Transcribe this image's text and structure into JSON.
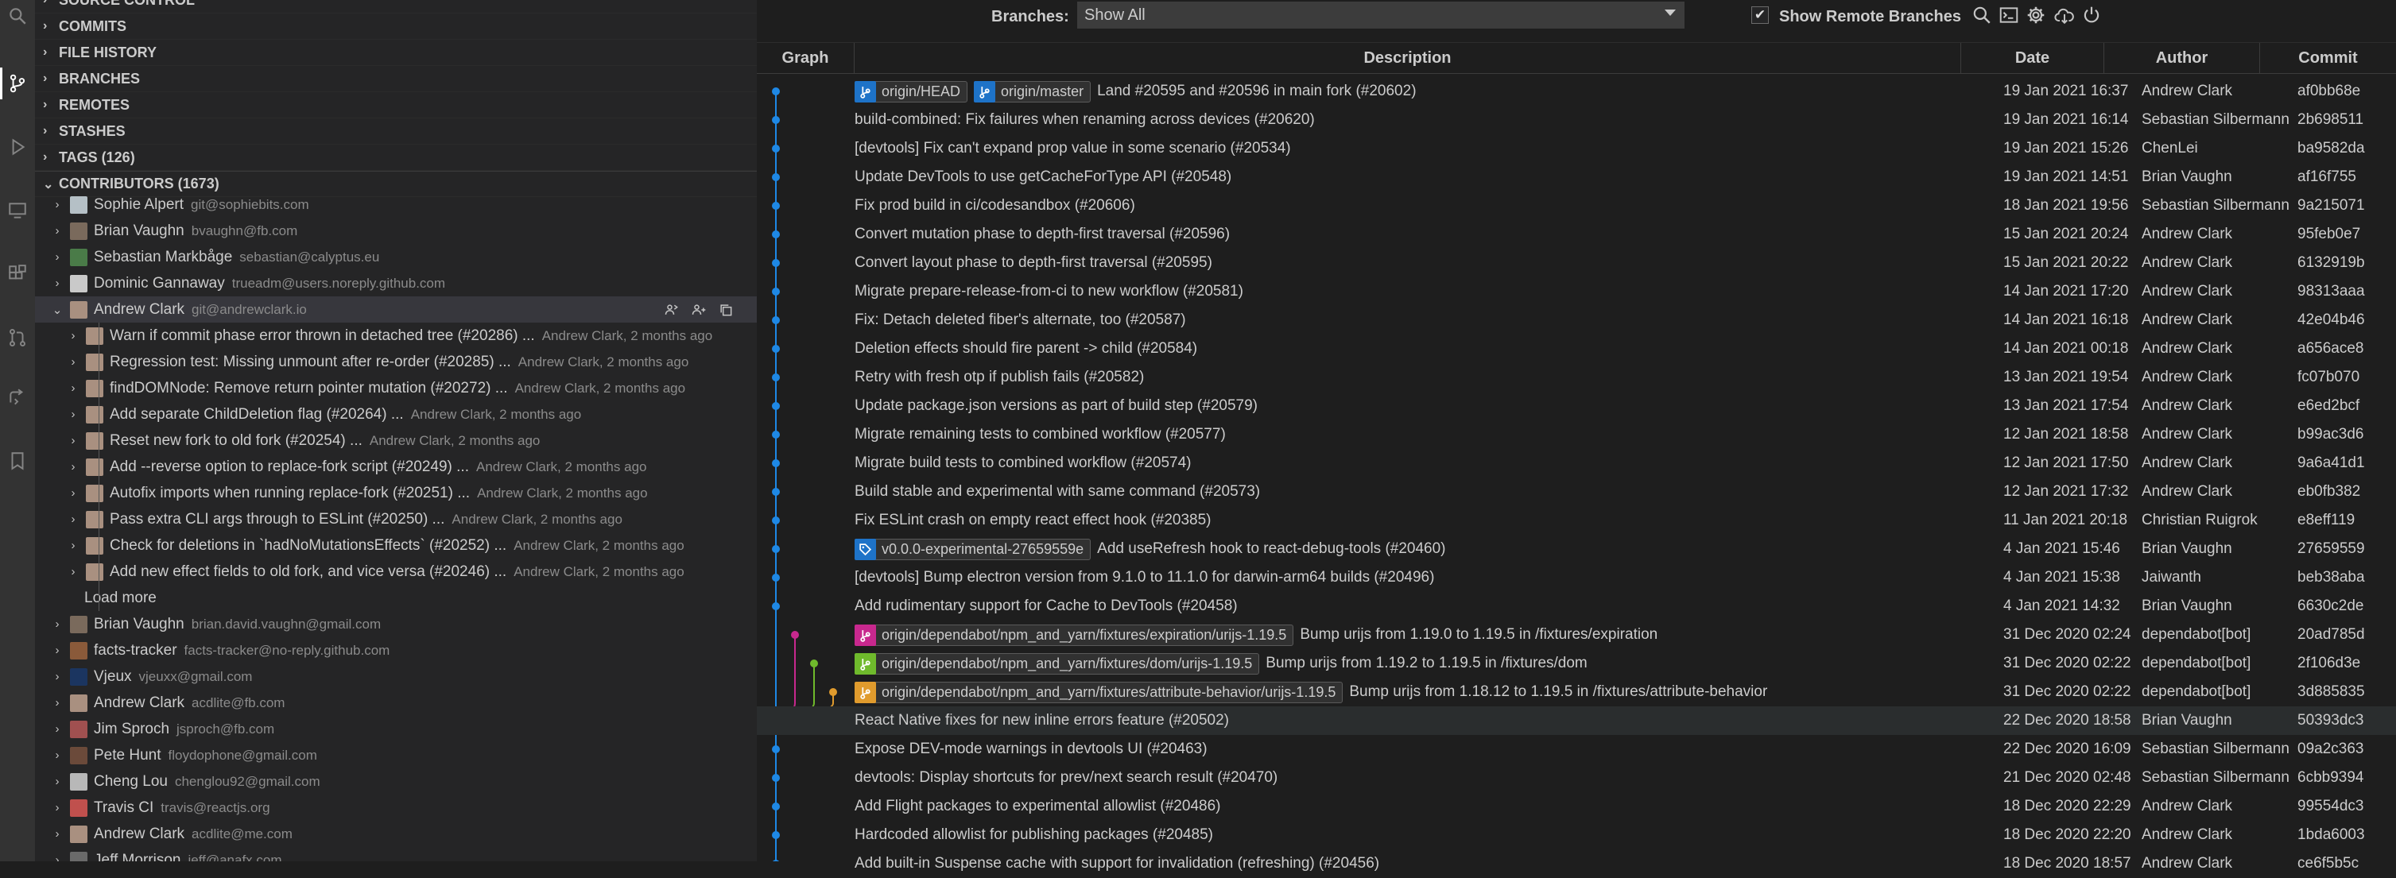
{
  "sidebar": {
    "sections": [
      {
        "label": "SOURCE CONTROL"
      },
      {
        "label": "COMMITS"
      },
      {
        "label": "FILE HISTORY"
      },
      {
        "label": "BRANCHES"
      },
      {
        "label": "REMOTES"
      },
      {
        "label": "STASHES"
      },
      {
        "label": "TAGS (126)"
      }
    ],
    "contributors_header": "CONTRIBUTORS (1673)",
    "contributors": [
      {
        "name": "Sophie Alpert",
        "email": "git@sophiebits.com",
        "color": "#b5c0c6"
      },
      {
        "name": "Brian Vaughn",
        "email": "bvaughn@fb.com",
        "color": "#7a6a5c"
      },
      {
        "name": "Sebastian Markbåge",
        "email": "sebastian@calyptus.eu",
        "color": "#4a7b48"
      },
      {
        "name": "Dominic Gannaway",
        "email": "trueadm@users.noreply.github.com",
        "color": "#c9c9c9"
      },
      {
        "name": "Andrew Clark",
        "email": "git@andrewclark.io",
        "color": "#a99080",
        "selected": true,
        "commits": [
          {
            "message": "Warn if commit phase error thrown in detached tree (#20286) ...",
            "desc": "Andrew Clark, 2 months ago"
          },
          {
            "message": "Regression test: Missing unmount after re-order (#20285) ...",
            "desc": "Andrew Clark, 2 months ago"
          },
          {
            "message": "findDOMNode: Remove return pointer mutation (#20272) ...",
            "desc": "Andrew Clark, 2 months ago"
          },
          {
            "message": "Add separate ChildDeletion flag (#20264) ...",
            "desc": "Andrew Clark, 2 months ago"
          },
          {
            "message": "Reset new fork to old fork  (#20254) ...",
            "desc": "Andrew Clark, 2 months ago"
          },
          {
            "message": "Add --reverse option to replace-fork script (#20249) ...",
            "desc": "Andrew Clark, 2 months ago"
          },
          {
            "message": "Autofix imports when running replace-fork (#20251) ...",
            "desc": "Andrew Clark, 2 months ago"
          },
          {
            "message": "Pass extra CLI args through to ESLint (#20250) ...",
            "desc": "Andrew Clark, 2 months ago"
          },
          {
            "message": "Check for deletions in `hadNoMutationsEffects` (#20252) ...",
            "desc": "Andrew Clark, 2 months ago"
          },
          {
            "message": "Add new effect fields to old fork, and vice versa (#20246) ...",
            "desc": "Andrew Clark, 2 months ago"
          }
        ],
        "load_more": "Load more"
      },
      {
        "name": "Brian Vaughn",
        "email": "brian.david.vaughn@gmail.com",
        "color": "#7a6a5c"
      },
      {
        "name": "facts-tracker",
        "email": "facts-tracker@no-reply.github.com",
        "color": "#8a5a3a"
      },
      {
        "name": "Vjeux",
        "email": "vjeuxx@gmail.com",
        "color": "#1b3560"
      },
      {
        "name": "Andrew Clark",
        "email": "acdlite@fb.com",
        "color": "#a99080"
      },
      {
        "name": "Jim Sproch",
        "email": "jsproch@fb.com",
        "color": "#a05050"
      },
      {
        "name": "Pete Hunt",
        "email": "floydophone@gmail.com",
        "color": "#6b4a3a"
      },
      {
        "name": "Cheng Lou",
        "email": "chenglou92@gmail.com",
        "color": "#b8b8b8"
      },
      {
        "name": "Travis CI",
        "email": "travis@reactjs.org",
        "color": "#c0504d"
      },
      {
        "name": "Andrew Clark",
        "email": "acdlite@me.com",
        "color": "#a99080"
      },
      {
        "name": "Jeff Morrison",
        "email": "jeff@anafx.com",
        "color": "#6a6a6a"
      }
    ]
  },
  "activity_icons": [
    "search-icon",
    "source-control-icon",
    "run-debug-icon",
    "remote-explorer-icon",
    "extensions-icon",
    "pull-request-icon",
    "live-share-icon",
    "bookmark-icon"
  ],
  "toolbar": {
    "branches_label": "Branches:",
    "branches_value": "Show All",
    "show_remote_label": "Show Remote Branches",
    "show_remote_checked": "✔",
    "icons": [
      "search-icon",
      "terminal-icon",
      "gear-icon",
      "cloud-download-icon",
      "refresh-icon"
    ]
  },
  "table": {
    "columns": {
      "graph": "Graph",
      "description": "Description",
      "date": "Date",
      "author": "Author",
      "commit": "Commit"
    },
    "rows": [
      {
        "refs": [
          {
            "label": "origin/HEAD",
            "color": "#1e73c8",
            "kind": "branch"
          },
          {
            "label": "origin/master",
            "color": "#1e73c8",
            "kind": "branch"
          }
        ],
        "message": "Land #20595 and #20596 in main fork (#20602)",
        "date": "19 Jan 2021 16:37",
        "author": "Andrew Clark",
        "commit": "af0bb68e"
      },
      {
        "refs": [],
        "message": "build-combined: Fix failures when renaming across devices (#20620)",
        "date": "19 Jan 2021 16:14",
        "author": "Sebastian Silbermann",
        "commit": "2b698511"
      },
      {
        "refs": [],
        "message": "[devtools] Fix can't expand prop value in some scenario (#20534)",
        "date": "19 Jan 2021 15:26",
        "author": "ChenLei",
        "commit": "ba9582da"
      },
      {
        "refs": [],
        "message": "Update DevTools to use getCacheForType API (#20548)",
        "date": "19 Jan 2021 14:51",
        "author": "Brian Vaughn",
        "commit": "af16f755"
      },
      {
        "refs": [],
        "message": "Fix prod build in ci/codesandbox (#20606)",
        "date": "18 Jan 2021 19:56",
        "author": "Sebastian Silbermann",
        "commit": "9a215071"
      },
      {
        "refs": [],
        "message": "Convert mutation phase to depth-first traversal (#20596)",
        "date": "15 Jan 2021 20:24",
        "author": "Andrew Clark",
        "commit": "95feb0e7"
      },
      {
        "refs": [],
        "message": "Convert layout phase to depth-first traversal (#20595)",
        "date": "15 Jan 2021 20:22",
        "author": "Andrew Clark",
        "commit": "6132919b"
      },
      {
        "refs": [],
        "message": "Migrate prepare-release-from-ci to new workflow (#20581)",
        "date": "14 Jan 2021 17:20",
        "author": "Andrew Clark",
        "commit": "98313aaa"
      },
      {
        "refs": [],
        "message": "Fix: Detach deleted fiber's alternate, too (#20587)",
        "date": "14 Jan 2021 16:18",
        "author": "Andrew Clark",
        "commit": "42e04b46"
      },
      {
        "refs": [],
        "message": "Deletion effects should fire parent -> child (#20584)",
        "date": "14 Jan 2021 00:18",
        "author": "Andrew Clark",
        "commit": "a656ace8"
      },
      {
        "refs": [],
        "message": "Retry with fresh otp if publish fails (#20582)",
        "date": "13 Jan 2021 19:54",
        "author": "Andrew Clark",
        "commit": "fc07b070"
      },
      {
        "refs": [],
        "message": "Update package.json versions as part of build step (#20579)",
        "date": "13 Jan 2021 17:54",
        "author": "Andrew Clark",
        "commit": "e6ed2bcf"
      },
      {
        "refs": [],
        "message": "Migrate remaining tests to combined workflow (#20577)",
        "date": "12 Jan 2021 18:58",
        "author": "Andrew Clark",
        "commit": "b99ac3d6"
      },
      {
        "refs": [],
        "message": "Migrate build tests to combined workflow (#20574)",
        "date": "12 Jan 2021 17:50",
        "author": "Andrew Clark",
        "commit": "9a6a41d1"
      },
      {
        "refs": [],
        "message": "Build stable and experimental with same command (#20573)",
        "date": "12 Jan 2021 17:32",
        "author": "Andrew Clark",
        "commit": "eb0fb382"
      },
      {
        "refs": [],
        "message": "Fix ESLint crash on empty react effect hook (#20385)",
        "date": "11 Jan 2021 20:18",
        "author": "Christian Ruigrok",
        "commit": "e8eff119"
      },
      {
        "refs": [
          {
            "label": "v0.0.0-experimental-27659559e",
            "color": "#1e73c8",
            "kind": "tag"
          }
        ],
        "message": "Add useRefresh hook to react-debug-tools (#20460)",
        "date": "4 Jan 2021 15:46",
        "author": "Brian Vaughn",
        "commit": "27659559"
      },
      {
        "refs": [],
        "message": "[devtools] Bump electron version from 9.1.0 to 11.1.0 for darwin-arm64 builds (#20496)",
        "date": "4 Jan 2021 15:38",
        "author": "Jaiwanth",
        "commit": "beb38aba"
      },
      {
        "refs": [],
        "message": "Add rudimentary support for Cache to DevTools (#20458)",
        "date": "4 Jan 2021 14:32",
        "author": "Brian Vaughn",
        "commit": "6630c2de"
      },
      {
        "refs": [
          {
            "label": "origin/dependabot/npm_and_yarn/fixtures/expiration/urijs-1.19.5",
            "color": "#c8288e",
            "kind": "branch"
          }
        ],
        "message": "Bump urijs from 1.19.0 to 1.19.5 in /fixtures/expiration",
        "date": "31 Dec 2020 02:24",
        "author": "dependabot[bot]",
        "commit": "20ad785d"
      },
      {
        "refs": [
          {
            "label": "origin/dependabot/npm_and_yarn/fixtures/dom/urijs-1.19.5",
            "color": "#6fba2c",
            "kind": "branch"
          }
        ],
        "message": "Bump urijs from 1.19.2 to 1.19.5 in /fixtures/dom",
        "date": "31 Dec 2020 02:22",
        "author": "dependabot[bot]",
        "commit": "2f106d3e"
      },
      {
        "refs": [
          {
            "label": "origin/dependabot/npm_and_yarn/fixtures/attribute-behavior/urijs-1.19.5",
            "color": "#e09b2d",
            "kind": "branch"
          }
        ],
        "message": "Bump urijs from 1.18.12 to 1.19.5 in /fixtures/attribute-behavior",
        "date": "31 Dec 2020 02:22",
        "author": "dependabot[bot]",
        "commit": "3d885835"
      },
      {
        "refs": [],
        "message": "React Native fixes for new inline errors feature (#20502)",
        "date": "22 Dec 2020 18:58",
        "author": "Brian Vaughn",
        "commit": "50393dc3",
        "highlight": true
      },
      {
        "refs": [],
        "message": "Expose DEV-mode warnings in devtools UI (#20463)",
        "date": "22 Dec 2020 16:09",
        "author": "Sebastian Silbermann",
        "commit": "09a2c363"
      },
      {
        "refs": [],
        "message": "devtools: Display shortcuts for prev/next search result (#20470)",
        "date": "21 Dec 2020 02:48",
        "author": "Sebastian Silbermann",
        "commit": "6cbb9394"
      },
      {
        "refs": [],
        "message": "Add Flight packages to experimental allowlist (#20486)",
        "date": "18 Dec 2020 22:29",
        "author": "Andrew Clark",
        "commit": "99554dc3"
      },
      {
        "refs": [],
        "message": "Hardcoded allowlist for publishing packages (#20485)",
        "date": "18 Dec 2020 22:20",
        "author": "Andrew Clark",
        "commit": "1bda6003"
      },
      {
        "refs": [],
        "message": "Add built-in Suspense cache with support for invalidation (refreshing) (#20456)",
        "date": "18 Dec 2020 18:57",
        "author": "Andrew Clark",
        "commit": "ce6f5b5c"
      }
    ]
  },
  "colors": {
    "graph_main": "#1e88e5",
    "accent": "#0e639c"
  }
}
